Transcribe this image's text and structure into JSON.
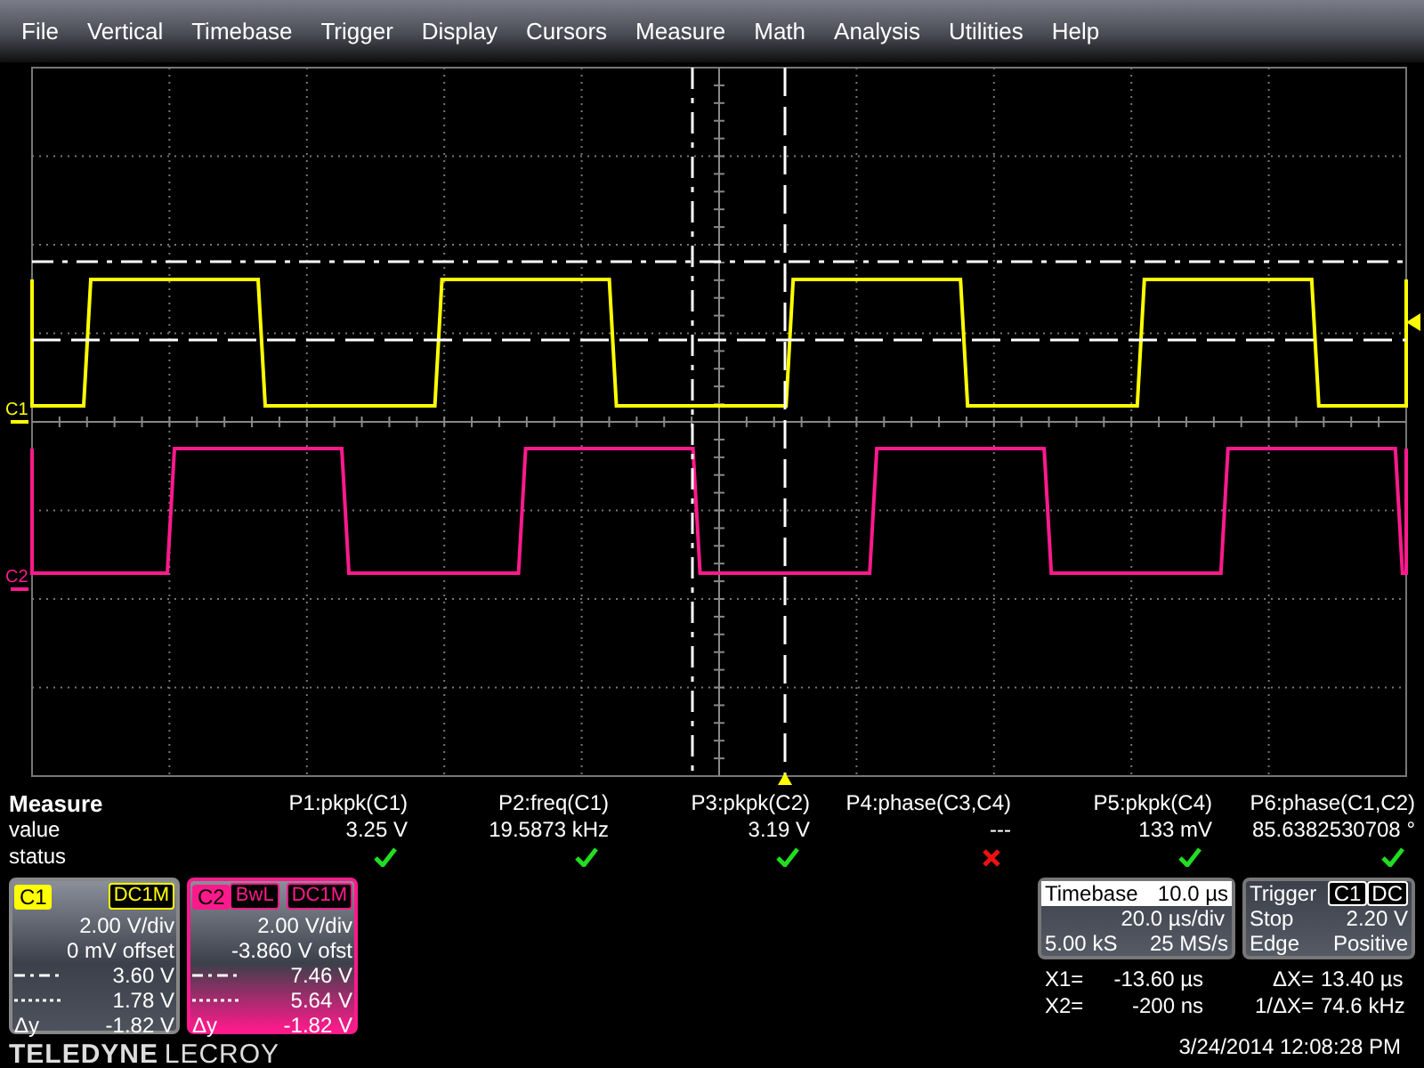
{
  "menu": [
    "File",
    "Vertical",
    "Timebase",
    "Trigger",
    "Display",
    "Cursors",
    "Measure",
    "Math",
    "Analysis",
    "Utilities",
    "Help"
  ],
  "measure": {
    "title": "Measure",
    "row_labels": [
      "value",
      "status"
    ],
    "params": [
      {
        "name": "P1:pkpk(C1)",
        "value": "3.25 V",
        "passed": true
      },
      {
        "name": "P2:freq(C1)",
        "value": "19.5873 kHz",
        "passed": true
      },
      {
        "name": "P3:pkpk(C2)",
        "value": "3.19 V",
        "passed": true
      },
      {
        "name": "P4:phase(C3,C4)",
        "value": "---",
        "passed": false
      },
      {
        "name": "P5:pkpk(C4)",
        "value": "133 mV",
        "passed": true
      },
      {
        "name": "P6:phase(C1,C2)",
        "value": "85.6382530708 °",
        "passed": true
      }
    ]
  },
  "channels": [
    {
      "trace_label": "C1",
      "label": "C1",
      "color": "#ffff00",
      "badges": [
        "DC1M"
      ],
      "scale": "2.00 V/div",
      "offset": "0 mV offset",
      "cursor_rows": [
        {
          "kind": "dash-dot",
          "value": "3.60 V"
        },
        {
          "kind": "dotted",
          "value": "1.78 V"
        },
        {
          "kind": "delta",
          "label": "Δy",
          "value": "-1.82 V"
        }
      ]
    },
    {
      "trace_label": "C2",
      "label": "C2",
      "color": "#ff1a8c",
      "badges": [
        "BwL",
        "DC1M"
      ],
      "scale": "2.00 V/div",
      "offset": "-3.860 V ofst",
      "cursor_rows": [
        {
          "kind": "dash-dot",
          "value": "7.46 V"
        },
        {
          "kind": "dotted",
          "value": "5.64 V"
        },
        {
          "kind": "delta",
          "label": "Δy",
          "value": "-1.82 V"
        }
      ]
    }
  ],
  "brand": {
    "name": "TELEDYNE",
    "suffix": "LECROY"
  },
  "timebase": {
    "title": "Timebase",
    "delay": "10.0 µs",
    "scale": "20.0 µs/div",
    "samples": "5.00 kS",
    "rate": "25 MS/s"
  },
  "trigger": {
    "title": "Trigger",
    "source": "C1",
    "coupling": "DC",
    "mode": "Stop",
    "level": "2.20 V",
    "type": "Edge",
    "slope": "Positive"
  },
  "cursor_readouts": [
    {
      "label": "X1=",
      "value": "-13.60 µs",
      "delta_label": "ΔX=",
      "delta_value": "13.40 µs"
    },
    {
      "label": "X2=",
      "value": "-200 ns",
      "delta_label": "1/ΔX=",
      "delta_value": "74.6 kHz"
    }
  ],
  "timestamp": "3/24/2014 12:08:28 PM"
}
